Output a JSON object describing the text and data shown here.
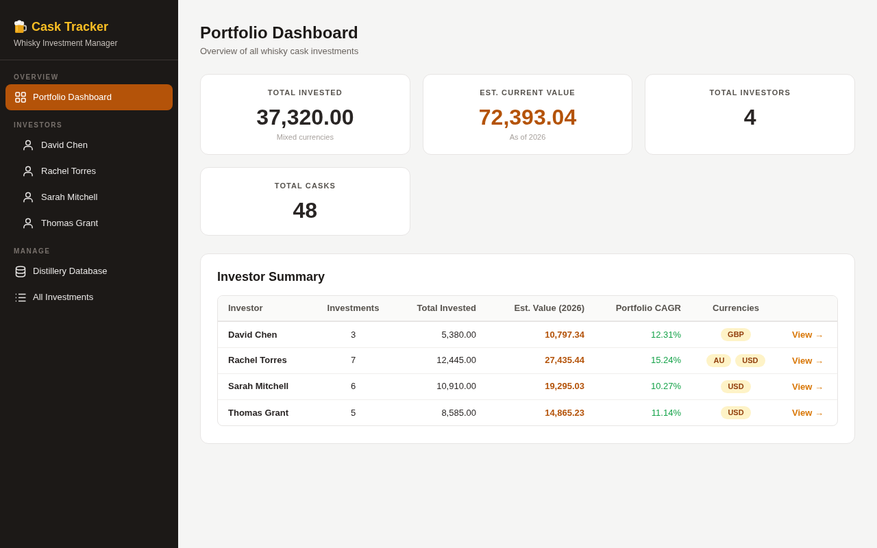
{
  "sidebar": {
    "brand": {
      "title": "Cask Tracker",
      "subtitle": "Whisky Investment Manager"
    },
    "sections": [
      {
        "label": "OVERVIEW",
        "items": [
          {
            "label": "Portfolio Dashboard",
            "kind": "dashboard",
            "selected": true
          }
        ]
      },
      {
        "label": "INVESTORS",
        "items": [
          {
            "label": "David Chen",
            "kind": "investor",
            "selected": false
          },
          {
            "label": "Rachel Torres",
            "kind": "investor",
            "selected": false
          },
          {
            "label": "Sarah Mitchell",
            "kind": "investor",
            "selected": false
          },
          {
            "label": "Thomas Grant",
            "kind": "investor",
            "selected": false
          }
        ]
      },
      {
        "label": "MANAGE",
        "items": [
          {
            "label": "Distillery Database",
            "kind": "distilleries",
            "selected": false
          },
          {
            "label": "All Investments",
            "kind": "investments",
            "selected": false
          }
        ]
      }
    ]
  },
  "header": {
    "title": "Portfolio Dashboard",
    "subtitle": "Overview of all whisky cask investments"
  },
  "stats": [
    {
      "label": "TOTAL INVESTED",
      "value": "37,320.00",
      "note": "Mixed currencies",
      "accent": false
    },
    {
      "label": "EST. CURRENT VALUE",
      "value": "72,393.04",
      "note": "As of 2026",
      "accent": true
    },
    {
      "label": "TOTAL INVESTORS",
      "value": "4",
      "accent": false
    },
    {
      "label": "TOTAL CASKS",
      "value": "48",
      "accent": false
    }
  ],
  "investor_summary": {
    "title": "Investor Summary",
    "columns": [
      "Investor",
      "Investments",
      "Total Invested",
      "Est. Value (2026)",
      "Portfolio CAGR",
      "Currencies"
    ],
    "rows": [
      {
        "investor": "David Chen",
        "investments": "3",
        "total_invested": "5,380.00",
        "est_value": "10,797.34",
        "cagr": "12.31%",
        "currencies": [
          "GBP"
        ],
        "action": "View →"
      },
      {
        "investor": "Rachel Torres",
        "investments": "7",
        "total_invested": "12,445.00",
        "est_value": "27,435.44",
        "cagr": "15.24%",
        "currencies": [
          "AU",
          "USD"
        ],
        "action": "View →"
      },
      {
        "investor": "Sarah Mitchell",
        "investments": "6",
        "total_invested": "10,910.00",
        "est_value": "19,295.03",
        "cagr": "10.27%",
        "currencies": [
          "USD"
        ],
        "action": "View →"
      },
      {
        "investor": "Thomas Grant",
        "investments": "5",
        "total_invested": "8,585.00",
        "est_value": "14,865.23",
        "cagr": "11.14%",
        "currencies": [
          "USD"
        ],
        "action": "View →"
      }
    ]
  }
}
